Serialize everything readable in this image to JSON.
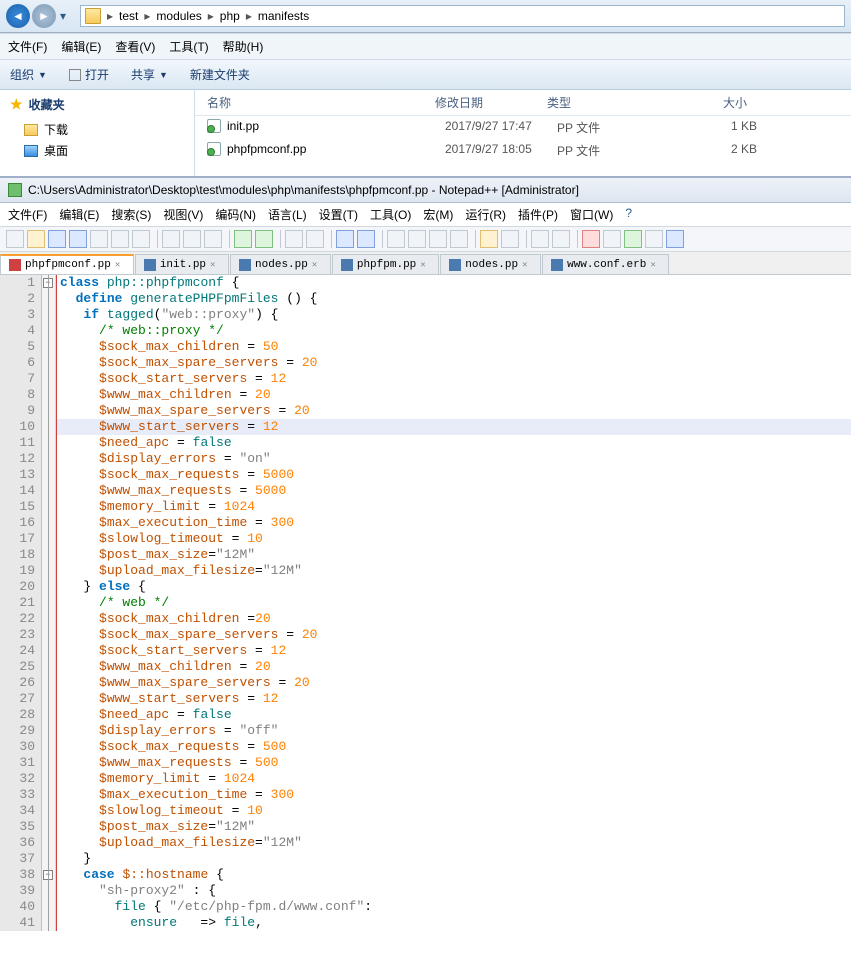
{
  "explorer": {
    "breadcrumb": [
      "test",
      "modules",
      "php",
      "manifests"
    ],
    "menu": [
      "文件(F)",
      "编辑(E)",
      "查看(V)",
      "工具(T)",
      "帮助(H)"
    ],
    "toolbar": {
      "organize": "组织",
      "open": "打开",
      "share": "共享",
      "newFolder": "新建文件夹"
    },
    "sidebar": {
      "favorites": "收藏夹",
      "downloads": "下载",
      "desktop": "桌面"
    },
    "columns": {
      "name": "名称",
      "date": "修改日期",
      "type": "类型",
      "size": "大小"
    },
    "files": [
      {
        "name": "init.pp",
        "date": "2017/9/27 17:47",
        "type": "PP 文件",
        "size": "1 KB"
      },
      {
        "name": "phpfpmconf.pp",
        "date": "2017/9/27 18:05",
        "type": "PP 文件",
        "size": "2 KB"
      }
    ]
  },
  "npp": {
    "title": "C:\\Users\\Administrator\\Desktop\\test\\modules\\php\\manifests\\phpfpmconf.pp - Notepad++ [Administrator]",
    "menu": [
      "文件(F)",
      "编辑(E)",
      "搜索(S)",
      "视图(V)",
      "编码(N)",
      "语言(L)",
      "设置(T)",
      "工具(O)",
      "宏(M)",
      "运行(R)",
      "插件(P)",
      "窗口(W)",
      "?"
    ],
    "tabs": [
      "phpfpmconf.pp",
      "init.pp",
      "nodes.pp",
      "phpfpm.pp",
      "nodes.pp",
      "www.conf.erb"
    ],
    "code": [
      {
        "n": 1,
        "tok": [
          [
            "kw",
            "class"
          ],
          [
            "op",
            " "
          ],
          [
            "ident",
            "php::phpfpmconf"
          ],
          [
            "op",
            " {"
          ]
        ]
      },
      {
        "n": 2,
        "tok": [
          [
            "op",
            "  "
          ],
          [
            "kw",
            "define"
          ],
          [
            "op",
            " "
          ],
          [
            "ident",
            "generatePHPFpmFiles"
          ],
          [
            "op",
            " () {"
          ]
        ]
      },
      {
        "n": 3,
        "tok": [
          [
            "op",
            "   "
          ],
          [
            "kw",
            "if"
          ],
          [
            "op",
            " "
          ],
          [
            "ident",
            "tagged"
          ],
          [
            "op",
            "("
          ],
          [
            "str",
            "\"web::proxy\""
          ],
          [
            "op",
            ") {"
          ]
        ]
      },
      {
        "n": 4,
        "tok": [
          [
            "op",
            "     "
          ],
          [
            "cmt",
            "/* web::proxy */"
          ]
        ]
      },
      {
        "n": 5,
        "tok": [
          [
            "op",
            "     "
          ],
          [
            "var",
            "$sock_max_children"
          ],
          [
            "op",
            " = "
          ],
          [
            "num",
            "50"
          ]
        ]
      },
      {
        "n": 6,
        "tok": [
          [
            "op",
            "     "
          ],
          [
            "var",
            "$sock_max_spare_servers"
          ],
          [
            "op",
            " = "
          ],
          [
            "num",
            "20"
          ]
        ]
      },
      {
        "n": 7,
        "tok": [
          [
            "op",
            "     "
          ],
          [
            "var",
            "$sock_start_servers"
          ],
          [
            "op",
            " = "
          ],
          [
            "num",
            "12"
          ]
        ]
      },
      {
        "n": 8,
        "tok": [
          [
            "op",
            "     "
          ],
          [
            "var",
            "$www_max_children"
          ],
          [
            "op",
            " = "
          ],
          [
            "num",
            "20"
          ]
        ]
      },
      {
        "n": 9,
        "tok": [
          [
            "op",
            "     "
          ],
          [
            "var",
            "$www_max_spare_servers"
          ],
          [
            "op",
            " = "
          ],
          [
            "num",
            "20"
          ]
        ]
      },
      {
        "n": 10,
        "hl": true,
        "tok": [
          [
            "op",
            "     "
          ],
          [
            "var",
            "$www_start_servers"
          ],
          [
            "op",
            " = "
          ],
          [
            "num",
            "12"
          ]
        ]
      },
      {
        "n": 11,
        "tok": [
          [
            "op",
            "     "
          ],
          [
            "var",
            "$need_apc"
          ],
          [
            "op",
            " = "
          ],
          [
            "ident",
            "false"
          ]
        ]
      },
      {
        "n": 12,
        "tok": [
          [
            "op",
            "     "
          ],
          [
            "var",
            "$display_errors"
          ],
          [
            "op",
            " = "
          ],
          [
            "str",
            "\"on\""
          ]
        ]
      },
      {
        "n": 13,
        "tok": [
          [
            "op",
            "     "
          ],
          [
            "var",
            "$sock_max_requests"
          ],
          [
            "op",
            " = "
          ],
          [
            "num",
            "5000"
          ]
        ]
      },
      {
        "n": 14,
        "tok": [
          [
            "op",
            "     "
          ],
          [
            "var",
            "$www_max_requests"
          ],
          [
            "op",
            " = "
          ],
          [
            "num",
            "5000"
          ]
        ]
      },
      {
        "n": 15,
        "tok": [
          [
            "op",
            "     "
          ],
          [
            "var",
            "$memory_limit"
          ],
          [
            "op",
            " = "
          ],
          [
            "num",
            "1024"
          ]
        ]
      },
      {
        "n": 16,
        "tok": [
          [
            "op",
            "     "
          ],
          [
            "var",
            "$max_execution_time"
          ],
          [
            "op",
            " = "
          ],
          [
            "num",
            "300"
          ]
        ]
      },
      {
        "n": 17,
        "tok": [
          [
            "op",
            "     "
          ],
          [
            "var",
            "$slowlog_timeout"
          ],
          [
            "op",
            " = "
          ],
          [
            "num",
            "10"
          ]
        ]
      },
      {
        "n": 18,
        "tok": [
          [
            "op",
            "     "
          ],
          [
            "var",
            "$post_max_size"
          ],
          [
            "op",
            "="
          ],
          [
            "str",
            "\"12M\""
          ]
        ]
      },
      {
        "n": 19,
        "tok": [
          [
            "op",
            "     "
          ],
          [
            "var",
            "$upload_max_filesize"
          ],
          [
            "op",
            "="
          ],
          [
            "str",
            "\"12M\""
          ]
        ]
      },
      {
        "n": 20,
        "tok": [
          [
            "op",
            "   } "
          ],
          [
            "kw",
            "else"
          ],
          [
            "op",
            " {"
          ]
        ]
      },
      {
        "n": 21,
        "tok": [
          [
            "op",
            "     "
          ],
          [
            "cmt",
            "/* web */"
          ]
        ]
      },
      {
        "n": 22,
        "tok": [
          [
            "op",
            "     "
          ],
          [
            "var",
            "$sock_max_children"
          ],
          [
            "op",
            " ="
          ],
          [
            "num",
            "20"
          ]
        ]
      },
      {
        "n": 23,
        "tok": [
          [
            "op",
            "     "
          ],
          [
            "var",
            "$sock_max_spare_servers"
          ],
          [
            "op",
            " = "
          ],
          [
            "num",
            "20"
          ]
        ]
      },
      {
        "n": 24,
        "tok": [
          [
            "op",
            "     "
          ],
          [
            "var",
            "$sock_start_servers"
          ],
          [
            "op",
            " = "
          ],
          [
            "num",
            "12"
          ]
        ]
      },
      {
        "n": 25,
        "tok": [
          [
            "op",
            "     "
          ],
          [
            "var",
            "$www_max_children"
          ],
          [
            "op",
            " = "
          ],
          [
            "num",
            "20"
          ]
        ]
      },
      {
        "n": 26,
        "tok": [
          [
            "op",
            "     "
          ],
          [
            "var",
            "$www_max_spare_servers"
          ],
          [
            "op",
            " = "
          ],
          [
            "num",
            "20"
          ]
        ]
      },
      {
        "n": 27,
        "tok": [
          [
            "op",
            "     "
          ],
          [
            "var",
            "$www_start_servers"
          ],
          [
            "op",
            " = "
          ],
          [
            "num",
            "12"
          ]
        ]
      },
      {
        "n": 28,
        "tok": [
          [
            "op",
            "     "
          ],
          [
            "var",
            "$need_apc"
          ],
          [
            "op",
            " = "
          ],
          [
            "ident",
            "false"
          ]
        ]
      },
      {
        "n": 29,
        "tok": [
          [
            "op",
            "     "
          ],
          [
            "var",
            "$display_errors"
          ],
          [
            "op",
            " = "
          ],
          [
            "str",
            "\"off\""
          ]
        ]
      },
      {
        "n": 30,
        "tok": [
          [
            "op",
            "     "
          ],
          [
            "var",
            "$sock_max_requests"
          ],
          [
            "op",
            " = "
          ],
          [
            "num",
            "500"
          ]
        ]
      },
      {
        "n": 31,
        "tok": [
          [
            "op",
            "     "
          ],
          [
            "var",
            "$www_max_requests"
          ],
          [
            "op",
            " = "
          ],
          [
            "num",
            "500"
          ]
        ]
      },
      {
        "n": 32,
        "tok": [
          [
            "op",
            "     "
          ],
          [
            "var",
            "$memory_limit"
          ],
          [
            "op",
            " = "
          ],
          [
            "num",
            "1024"
          ]
        ]
      },
      {
        "n": 33,
        "tok": [
          [
            "op",
            "     "
          ],
          [
            "var",
            "$max_execution_time"
          ],
          [
            "op",
            " = "
          ],
          [
            "num",
            "300"
          ]
        ]
      },
      {
        "n": 34,
        "tok": [
          [
            "op",
            "     "
          ],
          [
            "var",
            "$slowlog_timeout"
          ],
          [
            "op",
            " = "
          ],
          [
            "num",
            "10"
          ]
        ]
      },
      {
        "n": 35,
        "tok": [
          [
            "op",
            "     "
          ],
          [
            "var",
            "$post_max_size"
          ],
          [
            "op",
            "="
          ],
          [
            "str",
            "\"12M\""
          ]
        ]
      },
      {
        "n": 36,
        "tok": [
          [
            "op",
            "     "
          ],
          [
            "var",
            "$upload_max_filesize"
          ],
          [
            "op",
            "="
          ],
          [
            "str",
            "\"12M\""
          ]
        ]
      },
      {
        "n": 37,
        "tok": [
          [
            "op",
            "   }"
          ]
        ]
      },
      {
        "n": 38,
        "tok": [
          [
            "op",
            "   "
          ],
          [
            "kw",
            "case"
          ],
          [
            "op",
            " "
          ],
          [
            "var",
            "$::hostname"
          ],
          [
            "op",
            " {"
          ]
        ]
      },
      {
        "n": 39,
        "tok": [
          [
            "op",
            "     "
          ],
          [
            "str",
            "\"sh-proxy2\""
          ],
          [
            "op",
            " : {"
          ]
        ]
      },
      {
        "n": 40,
        "tok": [
          [
            "op",
            "       "
          ],
          [
            "ident",
            "file"
          ],
          [
            "op",
            " { "
          ],
          [
            "str",
            "\"/etc/php-fpm.d/www.conf\""
          ],
          [
            "op",
            ":"
          ]
        ]
      },
      {
        "n": 41,
        "tok": [
          [
            "op",
            "         "
          ],
          [
            "ident",
            "ensure"
          ],
          [
            "op",
            "   => "
          ],
          [
            "ident",
            "file"
          ],
          [
            "op",
            ","
          ]
        ]
      }
    ]
  }
}
